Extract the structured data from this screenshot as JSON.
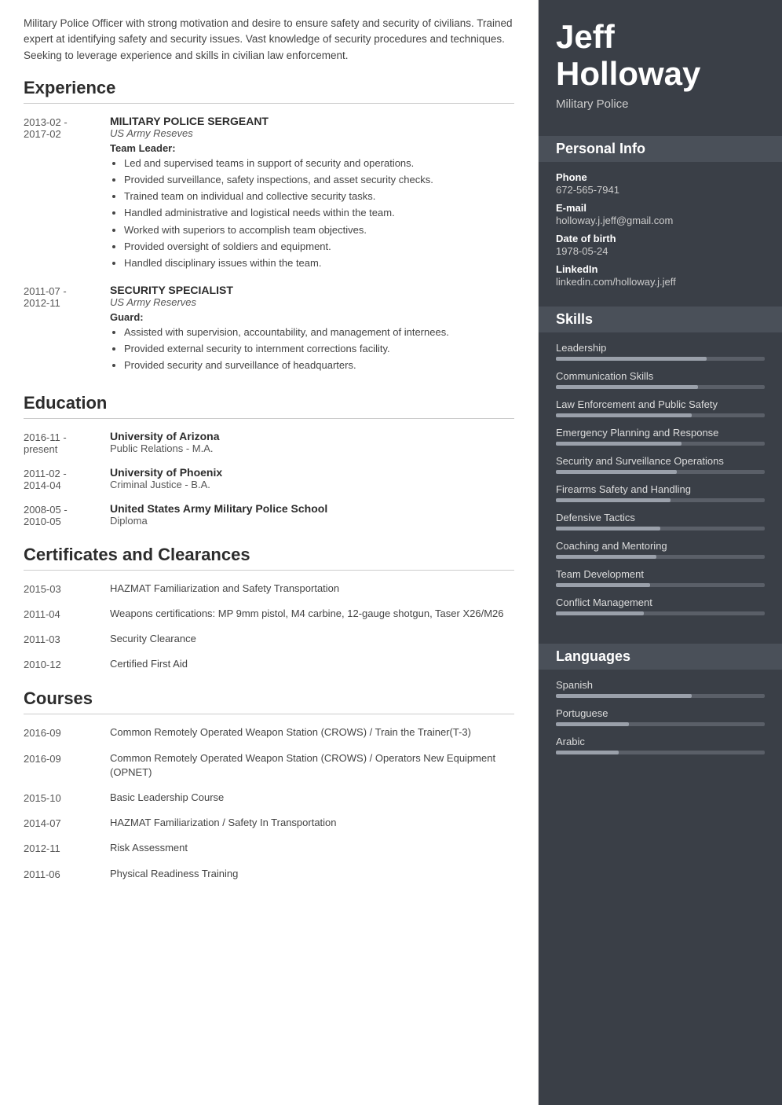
{
  "summary": "Military Police Officer with strong motivation and desire to ensure safety and security of civilians. Trained expert at identifying safety and security issues. Vast knowledge of security procedures and techniques. Seeking to leverage experience and skills in civilian law enforcement.",
  "sections": {
    "experience_title": "Experience",
    "education_title": "Education",
    "certs_title": "Certificates and Clearances",
    "courses_title": "Courses"
  },
  "experience": [
    {
      "date": "2013-02 -\n2017-02",
      "title": "MILITARY POLICE SERGEANT",
      "company": "US Army Reseves",
      "role_label": "Team Leader:",
      "bullets": [
        "Led and supervised teams in support of security and operations.",
        "Provided surveillance, safety inspections, and asset security checks.",
        "Trained team on individual and collective security tasks.",
        "Handled administrative and logistical needs within the team.",
        "Worked with superiors to accomplish team objectives.",
        "Provided oversight of soldiers and equipment.",
        "Handled disciplinary issues within the team."
      ]
    },
    {
      "date": "2011-07 -\n2012-11",
      "title": "SECURITY SPECIALIST",
      "company": "US Army Reserves",
      "role_label": "Guard:",
      "bullets": [
        "Assisted with supervision, accountability, and management of internees.",
        "Provided external security to internment corrections facility.",
        "Provided security and surveillance of headquarters."
      ]
    }
  ],
  "education": [
    {
      "date": "2016-11 -\npresent",
      "title": "University of Arizona",
      "degree": "Public Relations - M.A."
    },
    {
      "date": "2011-02 -\n2014-04",
      "title": "University of Phoenix",
      "degree": "Criminal Justice - B.A."
    },
    {
      "date": "2008-05 -\n2010-05",
      "title": "United States Army Military Police School",
      "degree": "Diploma"
    }
  ],
  "certificates": [
    {
      "date": "2015-03",
      "label": "HAZMAT Familiarization and Safety Transportation"
    },
    {
      "date": "2011-04",
      "label": "Weapons certifications: MP 9mm pistol, M4 carbine, 12-gauge shotgun, Taser X26/M26"
    },
    {
      "date": "2011-03",
      "label": "Security Clearance"
    },
    {
      "date": "2010-12",
      "label": "Certified First Aid"
    }
  ],
  "courses": [
    {
      "date": "2016-09",
      "label": "Common Remotely Operated Weapon Station (CROWS) / Train the Trainer(T-3)"
    },
    {
      "date": "2016-09",
      "label": "Common Remotely Operated Weapon Station (CROWS) / Operators New Equipment (OPNET)"
    },
    {
      "date": "2015-10",
      "label": "Basic Leadership Course"
    },
    {
      "date": "2014-07",
      "label": "HAZMAT Familiarization / Safety In Transportation"
    },
    {
      "date": "2012-11",
      "label": "Risk Assessment"
    },
    {
      "date": "2011-06",
      "label": "Physical Readiness Training"
    }
  ],
  "profile": {
    "first_name": "Jeff",
    "last_name": "Holloway",
    "job_title": "Military Police",
    "personal_info_title": "Personal Info",
    "phone_label": "Phone",
    "phone": "672-565-7941",
    "email_label": "E-mail",
    "email": "holloway.j.jeff@gmail.com",
    "dob_label": "Date of birth",
    "dob": "1978-05-24",
    "linkedin_label": "LinkedIn",
    "linkedin": "linkedin.com/holloway.j.jeff",
    "skills_title": "Skills",
    "skills": [
      {
        "name": "Leadership",
        "pct": 72
      },
      {
        "name": "Communication Skills",
        "pct": 68
      },
      {
        "name": "Law Enforcement and Public Safety",
        "pct": 65
      },
      {
        "name": "Emergency Planning and Response",
        "pct": 60
      },
      {
        "name": "Security and Surveillance Operations",
        "pct": 58
      },
      {
        "name": "Firearms Safety and Handling",
        "pct": 55
      },
      {
        "name": "Defensive Tactics",
        "pct": 50
      },
      {
        "name": "Coaching and Mentoring",
        "pct": 48
      },
      {
        "name": "Team Development",
        "pct": 45
      },
      {
        "name": "Conflict Management",
        "pct": 42
      }
    ],
    "languages_title": "Languages",
    "languages": [
      {
        "name": "Spanish",
        "pct": 65
      },
      {
        "name": "Portuguese",
        "pct": 35
      },
      {
        "name": "Arabic",
        "pct": 30
      }
    ]
  }
}
